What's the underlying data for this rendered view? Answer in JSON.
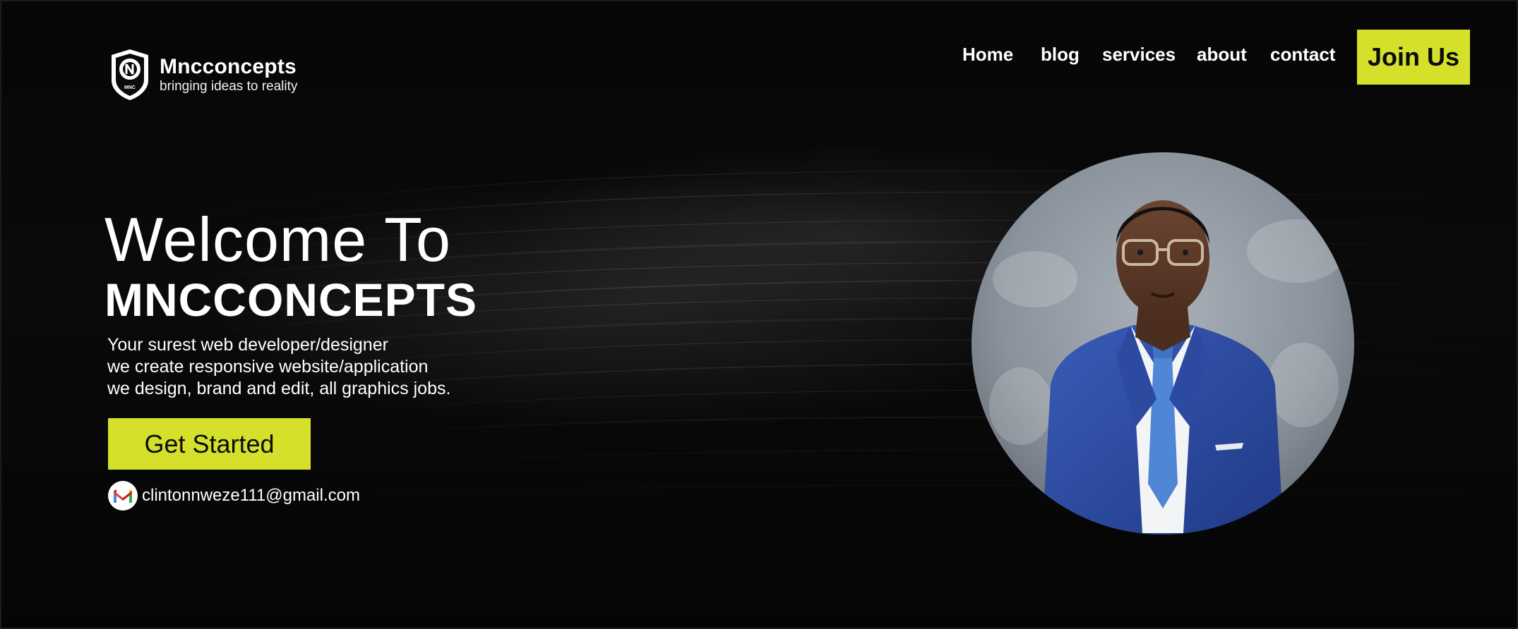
{
  "header": {
    "logo_name": "Mncconcepts",
    "logo_tagline": "bringing ideas to reality",
    "logo_badge_text": "MNC"
  },
  "nav": {
    "items": [
      {
        "label": "Home"
      },
      {
        "label": "blog"
      },
      {
        "label": "services"
      },
      {
        "label": "about"
      },
      {
        "label": "contact"
      }
    ],
    "join_label": "Join Us"
  },
  "hero": {
    "welcome": "Welcome To",
    "brand": "MNCCONCEPTS",
    "lines": [
      "Your surest web developer/designer",
      "we create responsive website/application",
      "we design, brand and edit, all  graphics jobs."
    ],
    "cta_label": "Get Started",
    "email": "clintonnweze111@gmail.com"
  },
  "icons": {
    "logo": "shield-logo-icon",
    "email": "gmail-icon",
    "portrait": "portrait-photo"
  },
  "colors": {
    "background": "#050505",
    "accent": "#d4e02a",
    "text": "#ffffff",
    "button_text": "#0b0b0b"
  }
}
